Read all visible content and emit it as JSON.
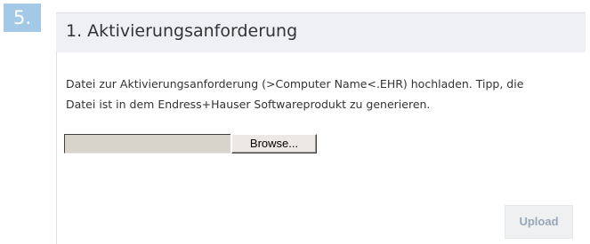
{
  "step": {
    "number": "5."
  },
  "panel": {
    "title": "1. Aktivierungsanforderung",
    "description_line1": "Datei zur Aktivierungsanforderung (>Computer Name<.EHR) hochladen. Tipp, die",
    "description_line2": "Datei ist in dem Endress+Hauser Softwareprodukt zu generieren."
  },
  "file_picker": {
    "value": "",
    "browse_label": "Browse..."
  },
  "actions": {
    "upload_label": "Upload"
  },
  "colors": {
    "step_badge": "#a3c9e6",
    "panel_header": "#eef0f4",
    "upload_text_disabled": "#99a8b8"
  }
}
